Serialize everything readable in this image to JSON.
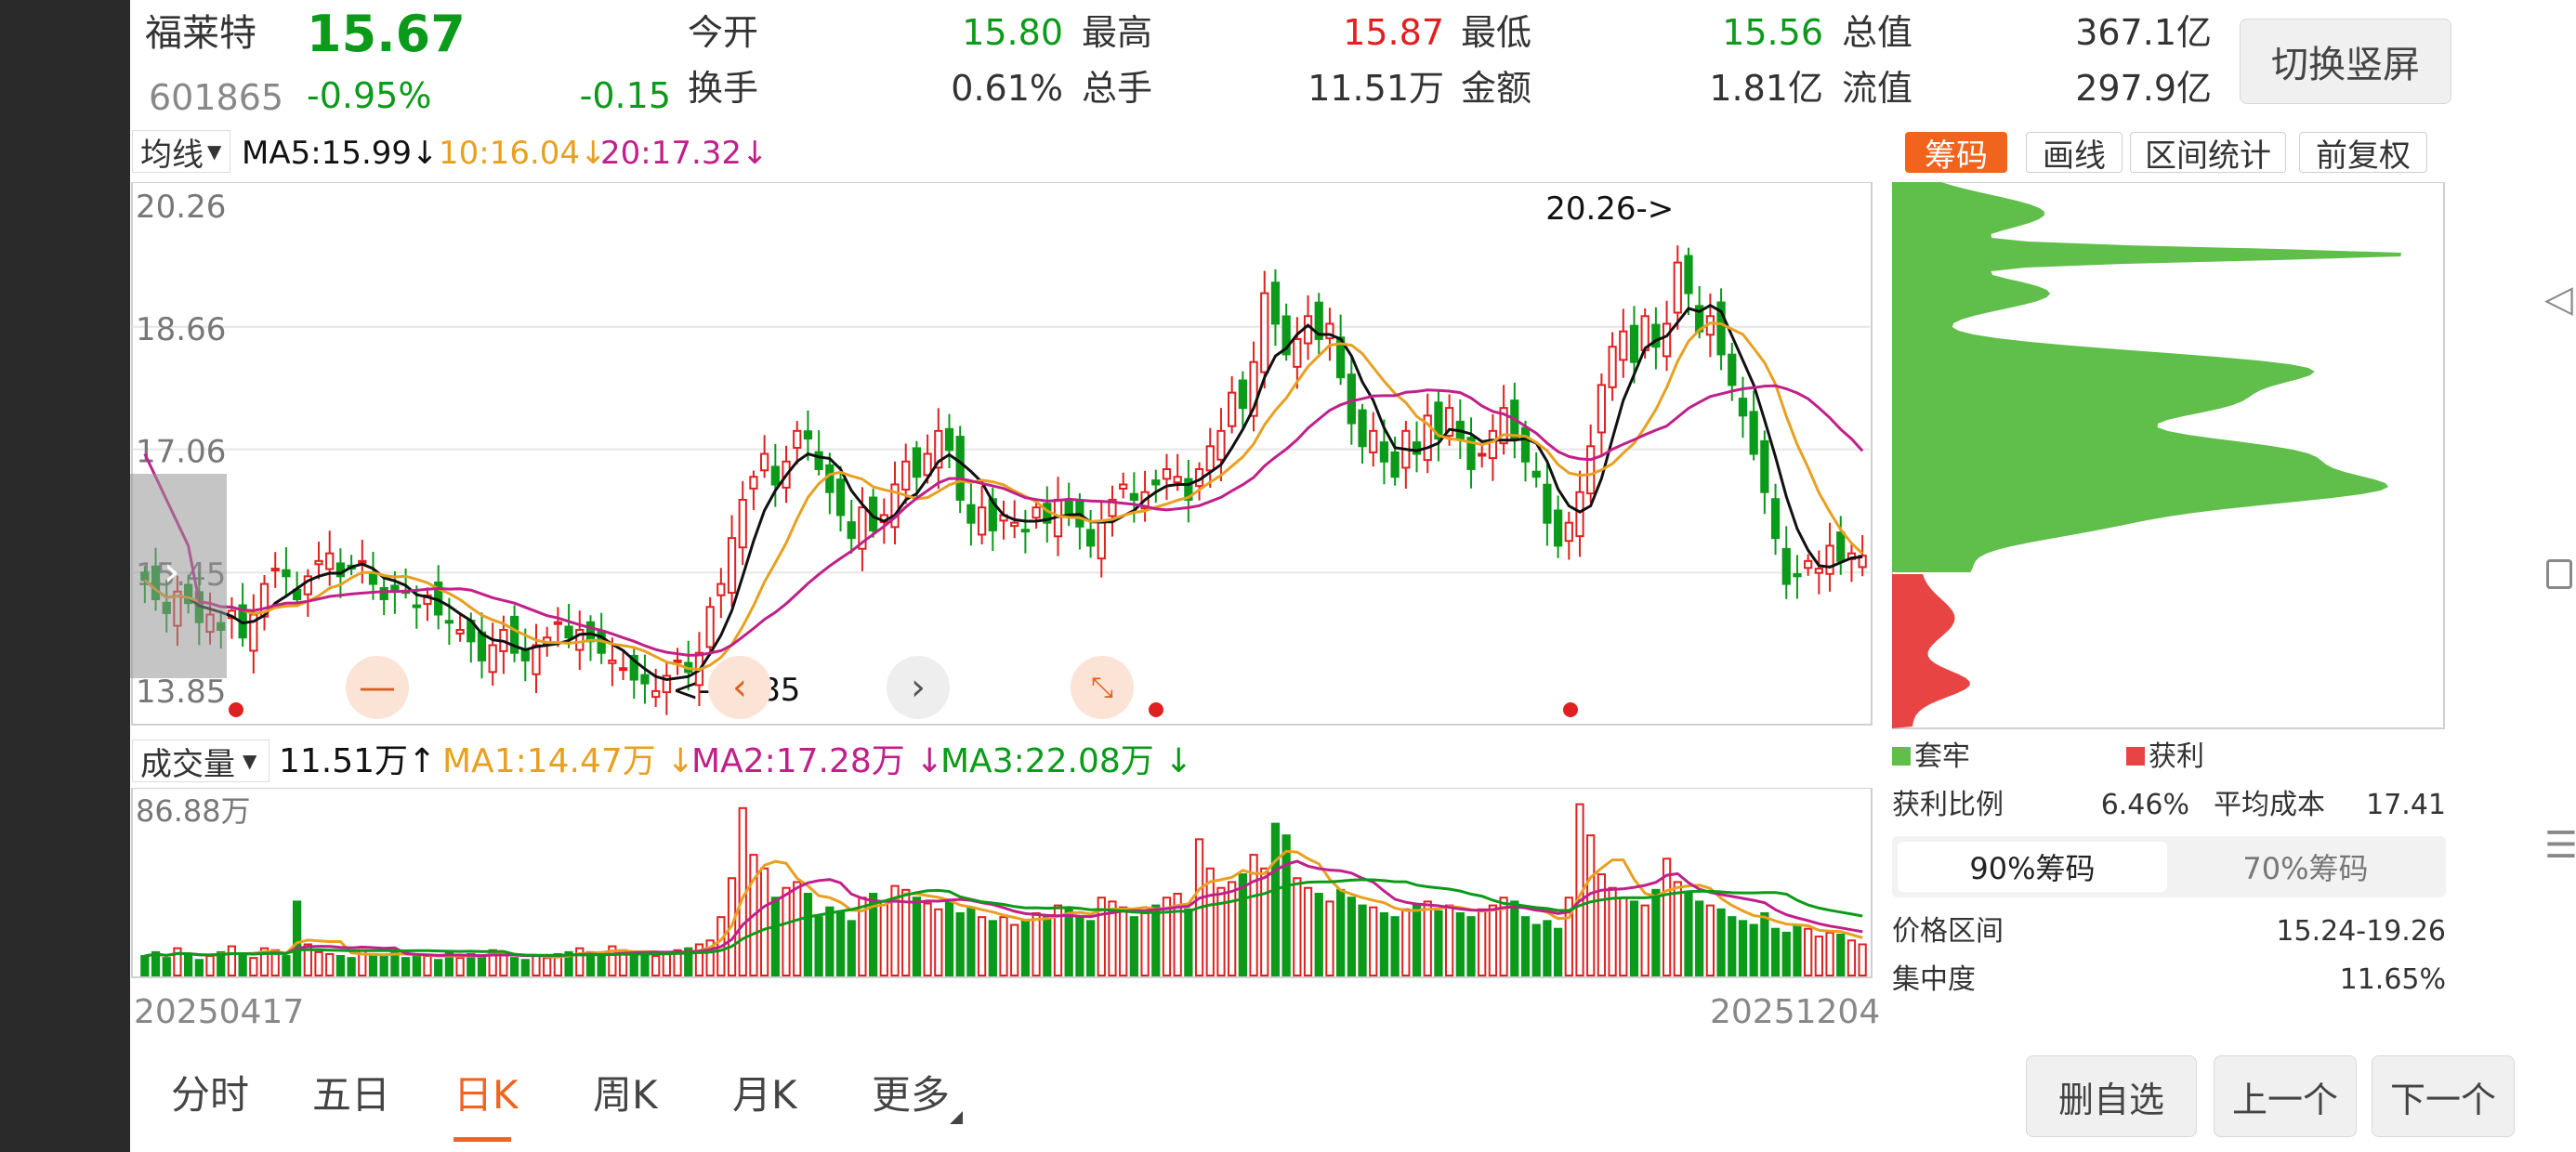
{
  "header": {
    "name": "福莱特",
    "price": "15.67",
    "code": "601865",
    "change_pct": "-0.95%",
    "change": "-0.15",
    "stats": [
      {
        "label": "今开",
        "value": "15.80",
        "color": "green"
      },
      {
        "label": "最高",
        "value": "15.87",
        "color": "red"
      },
      {
        "label": "最低",
        "value": "15.56",
        "color": "green"
      },
      {
        "label": "总值",
        "value": "367.1亿",
        "color": "dark"
      },
      {
        "label": "换手",
        "value": "0.61%",
        "color": "dark"
      },
      {
        "label": "总手",
        "value": "11.51万",
        "color": "dark"
      },
      {
        "label": "金额",
        "value": "1.81亿",
        "color": "dark"
      },
      {
        "label": "流值",
        "value": "297.9亿",
        "color": "dark"
      }
    ],
    "switch_button": "切换竖屏"
  },
  "ma_legend": {
    "selector": "均线",
    "ma5": "MA5:15.99",
    "ma10": "10:16.04",
    "ma20": "20:17.32"
  },
  "chip_tabs": [
    {
      "label": "筹码",
      "active": true
    },
    {
      "label": "画线",
      "active": false
    },
    {
      "label": "区间统计",
      "active": false
    },
    {
      "label": "前复权",
      "active": false
    }
  ],
  "vol_legend": {
    "selector": "成交量",
    "vol": "11.51万",
    "ma1": "MA1:14.47万",
    "ma2": "MA2:17.28万",
    "ma3": "MA3:22.08万",
    "max_label": "86.88万"
  },
  "dates": {
    "start": "20250417",
    "end": "20251204"
  },
  "chip_panel": {
    "legend_loss": "套牢",
    "legend_profit": "获利",
    "profit_ratio_label": "获利比例",
    "profit_ratio": "6.46%",
    "avg_cost_label": "平均成本",
    "avg_cost": "17.41",
    "tab90": "90%筹码",
    "tab70": "70%筹码",
    "range_label": "价格区间",
    "range": "15.24-19.26",
    "conc_label": "集中度",
    "conc": "11.65%"
  },
  "period_tabs": [
    {
      "label": "分时",
      "active": false
    },
    {
      "label": "五日",
      "active": false
    },
    {
      "label": "日K",
      "active": true
    },
    {
      "label": "周K",
      "active": false
    },
    {
      "label": "月K",
      "active": false
    },
    {
      "label": "更多",
      "active": false
    }
  ],
  "bottom_buttons": {
    "remove": "删自选",
    "prev": "上一个",
    "next": "下一个"
  },
  "colors": {
    "up": "#e02020",
    "down": "#0b9a19",
    "ma5": "#111111",
    "ma10": "#e8a020",
    "ma20": "#c0208a",
    "accent": "#f0641e"
  },
  "chart_data": {
    "type": "candlestick",
    "yticks": [
      "20.26",
      "18.66",
      "17.06",
      "15.45",
      "13.85"
    ],
    "ylim": [
      13.85,
      20.26
    ],
    "high_marker": "20.26->",
    "low_marker": "<-13.85",
    "close": [
      15.35,
      15.1,
      14.92,
      15.2,
      15.05,
      14.8,
      14.9,
      14.7,
      14.95,
      14.6,
      14.9,
      15.3,
      15.5,
      15.4,
      15.1,
      15.4,
      15.6,
      15.7,
      15.4,
      15.5,
      15.6,
      15.3,
      15.1,
      15.2,
      15.2,
      15.0,
      15.15,
      14.9,
      14.8,
      14.7,
      14.55,
      14.3,
      14.5,
      14.7,
      14.4,
      14.3,
      14.5,
      14.6,
      14.8,
      14.6,
      14.7,
      14.55,
      14.4,
      14.3,
      14.2,
      14.05,
      14.0,
      13.9,
      14.1,
      14.3,
      14.15,
      14.4,
      15.0,
      15.3,
      15.9,
      16.4,
      16.7,
      17.0,
      16.6,
      16.9,
      17.3,
      17.2,
      16.8,
      16.5,
      16.2,
      15.9,
      16.3,
      16.0,
      16.2,
      16.6,
      16.9,
      16.7,
      17.0,
      17.3,
      17.05,
      16.4,
      16.1,
      16.3,
      16.0,
      16.2,
      16.1,
      16.0,
      16.3,
      16.1,
      16.4,
      16.2,
      16.05,
      15.8,
      16.1,
      16.4,
      16.6,
      16.4,
      16.5,
      16.6,
      16.8,
      16.7,
      16.4,
      16.8,
      17.1,
      17.3,
      17.8,
      17.6,
      18.2,
      19.1,
      18.7,
      18.3,
      18.5,
      18.8,
      18.5,
      18.7,
      18.0,
      17.4,
      17.1,
      17.3,
      16.9,
      16.7,
      17.3,
      17.0,
      17.5,
      17.2,
      17.6,
      17.2,
      16.8,
      17.0,
      17.3,
      17.6,
      17.2,
      16.9,
      16.7,
      16.1,
      15.8,
      16.1,
      16.5,
      17.1,
      17.9,
      18.4,
      18.6,
      18.2,
      18.8,
      18.4,
      18.7,
      19.5,
      19.1,
      18.6,
      18.8,
      18.3,
      17.9,
      17.5,
      17.0,
      16.5,
      15.9,
      15.3,
      15.4,
      15.6,
      15.5,
      15.8,
      15.6,
      15.7,
      15.67
    ],
    "volume": [
      10,
      12,
      9,
      14,
      11,
      8,
      10,
      12,
      15,
      11,
      9,
      14,
      13,
      10,
      38,
      16,
      12,
      11,
      10,
      9,
      13,
      11,
      10,
      12,
      9,
      11,
      10,
      8,
      12,
      9,
      11,
      10,
      13,
      12,
      9,
      8,
      10,
      9,
      11,
      12,
      14,
      12,
      10,
      15,
      13,
      11,
      12,
      10,
      11,
      13,
      14,
      16,
      18,
      30,
      50,
      86,
      62,
      55,
      40,
      45,
      48,
      42,
      30,
      35,
      33,
      28,
      40,
      42,
      38,
      46,
      44,
      40,
      37,
      34,
      38,
      32,
      35,
      30,
      28,
      30,
      26,
      28,
      32,
      30,
      36,
      34,
      30,
      28,
      40,
      38,
      35,
      30,
      32,
      36,
      40,
      42,
      34,
      70,
      55,
      45,
      48,
      52,
      62,
      55,
      78,
      72,
      50,
      45,
      42,
      38,
      44,
      40,
      36,
      35,
      32,
      30,
      34,
      36,
      38,
      33,
      36,
      32,
      30,
      34,
      36,
      40,
      38,
      30,
      26,
      28,
      24,
      40,
      88,
      72,
      52,
      45,
      40,
      38,
      36,
      44,
      60,
      48,
      42,
      38,
      36,
      34,
      30,
      28,
      26,
      32,
      24,
      22,
      26,
      24,
      20,
      22,
      21,
      18,
      16
    ],
    "vol_ylim": [
      0,
      86.88
    ]
  }
}
